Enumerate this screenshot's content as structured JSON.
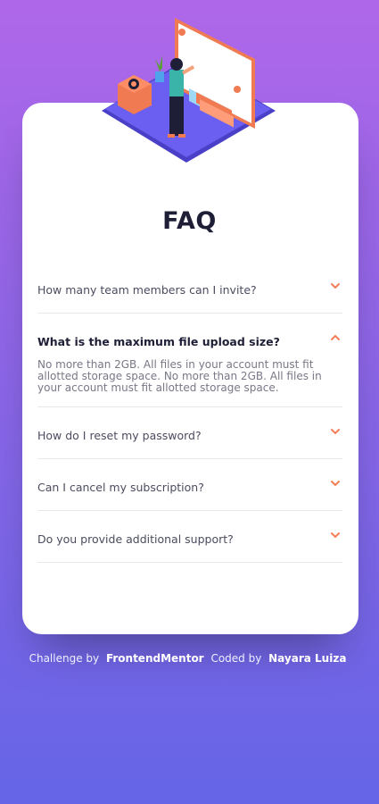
{
  "colors": {
    "accent": "#f47c57",
    "title": "#1e1f36",
    "question": "#4b4c5f",
    "answer": "#787887",
    "divider": "#e8e8ea",
    "bg_top": "#af67e9",
    "bg_bottom": "#6565e7"
  },
  "page": {
    "title": "FAQ"
  },
  "faq": [
    {
      "question": "How many team members can I invite?",
      "open": false,
      "icon": "chevron-down-icon"
    },
    {
      "question": "What is the maximum file upload size?",
      "open": true,
      "icon": "chevron-up-icon",
      "answer": "No more than 2GB. All files in your account must fit allotted storage space. No more than 2GB. All files in your account must fit allotted storage space."
    },
    {
      "question": "How do I reset my password?",
      "open": false,
      "icon": "chevron-down-icon"
    },
    {
      "question": "Can I cancel my subscription?",
      "open": false,
      "icon": "chevron-down-icon"
    },
    {
      "question": "Do you provide additional support?",
      "open": false,
      "icon": "chevron-down-icon"
    }
  ],
  "footer": {
    "challenge_prefix": "Challenge by",
    "challenge_link": "FrontendMentor",
    "coded_prefix": "Coded by",
    "coded_link": "Nayara Luiza"
  }
}
